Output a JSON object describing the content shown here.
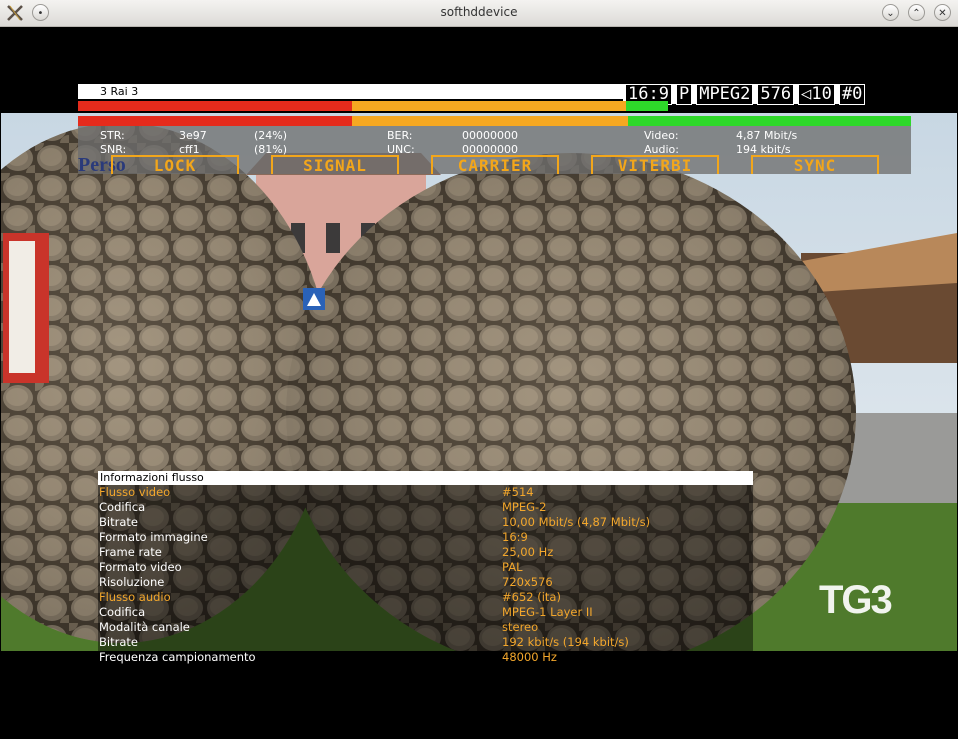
{
  "window": {
    "title": "softhddevice"
  },
  "channel": {
    "name": "3 Rai 3",
    "badges": [
      "16:9",
      "P",
      "MPEG2",
      "576",
      "◁10",
      "#0"
    ]
  },
  "progress": {
    "elapsed_fraction": 0.59,
    "colors": [
      "#e52b1c",
      "#f6a821",
      "#2ed82a"
    ]
  },
  "signal": {
    "strength_fraction": 0.67,
    "str_label": "STR:",
    "str_value": "3e97",
    "str_pct": "(24%)",
    "snr_label": "SNR:",
    "snr_value": "cff1",
    "snr_pct": "(81%)",
    "ber_label": "BER:",
    "ber_value": "00000000",
    "unc_label": "UNC:",
    "unc_value": "00000000",
    "video_label": "Video:",
    "video_value": "4,87 Mbit/s",
    "audio_label": "Audio:",
    "audio_value": "194 kbit/s",
    "status": [
      "LOCK",
      "SIGNAL",
      "CARRIER",
      "VITERBI",
      "SYNC"
    ],
    "logo": "Perso"
  },
  "stream_info": {
    "title": "Informazioni flusso",
    "rows": [
      {
        "label": "Flusso video",
        "value": "#514",
        "header": true
      },
      {
        "label": "Codifica",
        "value": "MPEG-2"
      },
      {
        "label": "Bitrate",
        "value": "10,00 Mbit/s (4,87 Mbit/s)"
      },
      {
        "label": "Formato immagine",
        "value": "16:9"
      },
      {
        "label": "Frame rate",
        "value": "25,00 Hz"
      },
      {
        "label": "Formato video",
        "value": "PAL"
      },
      {
        "label": "Risoluzione",
        "value": "720x576"
      },
      {
        "label": "Flusso audio",
        "value": "#652 (ita)",
        "header": true
      },
      {
        "label": "Codifica",
        "value": "MPEG-1 Layer II"
      },
      {
        "label": "Modalità canale",
        "value": "stereo"
      },
      {
        "label": "Bitrate",
        "value": "192 kbit/s (194 kbit/s)"
      },
      {
        "label": "Frequenza campionamento",
        "value": "48000 Hz"
      }
    ]
  },
  "overlay_logo": "TG3"
}
